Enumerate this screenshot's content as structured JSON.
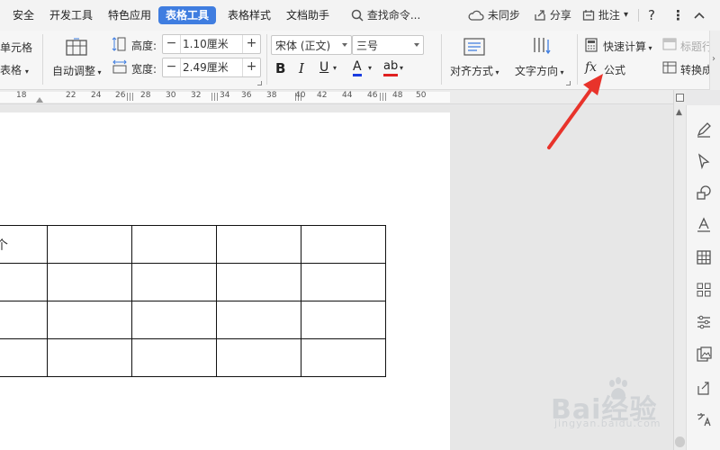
{
  "menubar": {
    "tabs": [
      "安全",
      "开发工具",
      "特色应用",
      "表格工具",
      "表格样式",
      "文档助手"
    ],
    "active_tab": "表格工具",
    "search_label": "查找命令...",
    "sync_label": "未同步",
    "share_label": "分享",
    "comment_label": "批注",
    "help_label": "?"
  },
  "ribbon": {
    "split_cell_label": "单元格",
    "split_table_label": "表格",
    "auto_adjust_label": "自动调整",
    "height_label": "高度:",
    "height_value": "1.10厘米",
    "width_label": "宽度:",
    "width_value": "2.49厘米",
    "font_name": "宋体 (正文)",
    "font_size": "三号",
    "bold_label": "B",
    "italic_label": "I",
    "underline_label": "U",
    "font_color_label": "A",
    "highlight_label": "ab",
    "align_label": "对齐方式",
    "text_direction_label": "文字方向",
    "quick_calc_label": "快速计算",
    "formula_icon_label": "fx",
    "formula_label": "公式",
    "title_row_label": "标题行",
    "convert_label": "转换成",
    "accent_color": "#3f7de0",
    "font_color": "#1a3ce0",
    "highlight_color": "#e02020"
  },
  "ruler": {
    "numbers": [
      "18",
      "22",
      "24",
      "26",
      "28",
      "30",
      "32",
      "34",
      "36",
      "38",
      "40",
      "42",
      "44",
      "46",
      "48",
      "50"
    ]
  },
  "table": {
    "rows": [
      [
        "个",
        "",
        "",
        "",
        ""
      ],
      [
        "",
        "",
        "",
        "",
        ""
      ],
      [
        "",
        "",
        "",
        "",
        ""
      ],
      [
        "",
        "",
        "",
        "",
        ""
      ]
    ]
  },
  "watermark": {
    "brand": "Bai经验",
    "url": "jingyan.baidu.com"
  },
  "annotation": {
    "arrow_color": "#e8332b"
  }
}
